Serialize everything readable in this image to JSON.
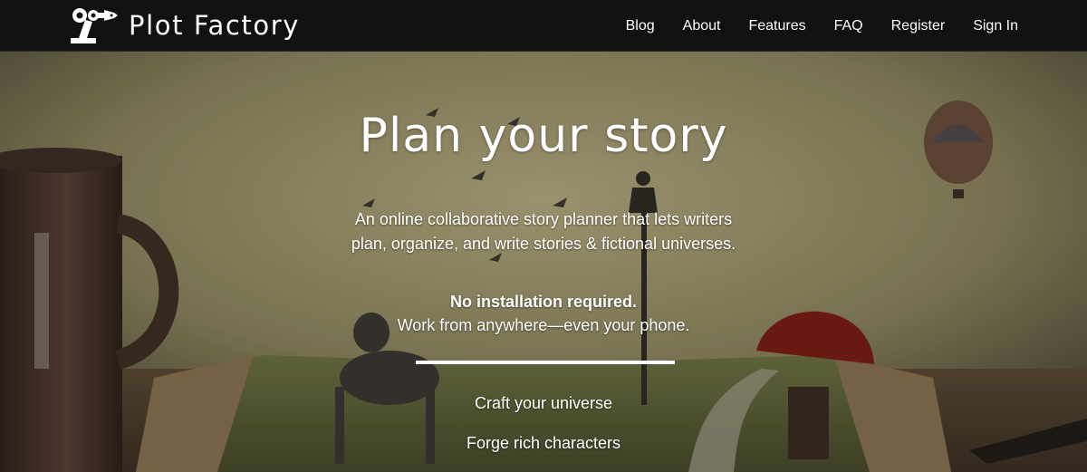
{
  "brand": {
    "name": "Plot Factory",
    "logo": "robot-arm-pen-logo"
  },
  "nav": {
    "items": [
      {
        "label": "Blog"
      },
      {
        "label": "About"
      },
      {
        "label": "Features"
      },
      {
        "label": "FAQ"
      },
      {
        "label": "Register"
      },
      {
        "label": "Sign In"
      }
    ]
  },
  "hero": {
    "title": "Plan your story",
    "tagline": "An online collaborative story planner that lets writers plan, organize, and write stories & fictional universes.",
    "bold_line": "No installation required.",
    "sub_line": "Work from anywhere—even your phone.",
    "features": [
      {
        "label": "Craft your universe"
      },
      {
        "label": "Forge rich characters"
      }
    ]
  },
  "colors": {
    "navbar": "#111111",
    "text": "#ffffff"
  }
}
